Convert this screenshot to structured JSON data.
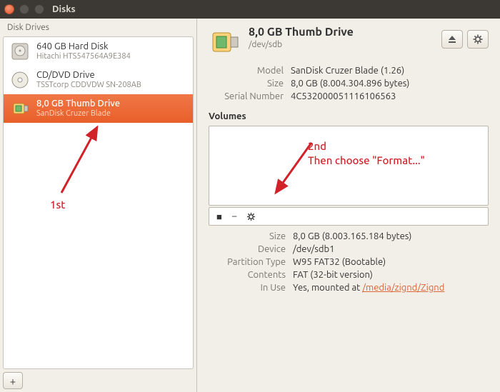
{
  "window": {
    "title": "Disks"
  },
  "sidebar": {
    "header": "Disk Drives",
    "drives": [
      {
        "name": "640 GB Hard Disk",
        "sub": "Hitachi HTS547564A9E384"
      },
      {
        "name": "CD/DVD Drive",
        "sub": "TSSTcorp CDDVDW SN-208AB"
      },
      {
        "name": "8,0 GB Thumb Drive",
        "sub": "SanDisk Cruzer Blade"
      }
    ]
  },
  "device": {
    "title": "8,0 GB Thumb Drive",
    "path": "/dev/sdb",
    "model_label": "Model",
    "model_value": "SanDisk Cruzer Blade (1.26)",
    "size_label": "Size",
    "size_value": "8,0 GB (8.004.304.896 bytes)",
    "serial_label": "Serial Number",
    "serial_value": "4C532000051116106563"
  },
  "volumes": {
    "header": "Volumes",
    "rows": {
      "size_label": "Size",
      "size_value": "8,0 GB (8.003.165.184 bytes)",
      "device_label": "Device",
      "device_value": "/dev/sdb1",
      "ptype_label": "Partition Type",
      "ptype_value": "W95 FAT32 (Bootable)",
      "contents_label": "Contents",
      "contents_value": "FAT (32-bit version)",
      "inuse_label": "In Use",
      "inuse_prefix": "Yes, mounted at ",
      "inuse_link": "/media/zignd/Zignd"
    }
  },
  "annotations": {
    "first": "1st",
    "second_line1": "2nd",
    "second_line2": "Then choose \"Format...\""
  }
}
